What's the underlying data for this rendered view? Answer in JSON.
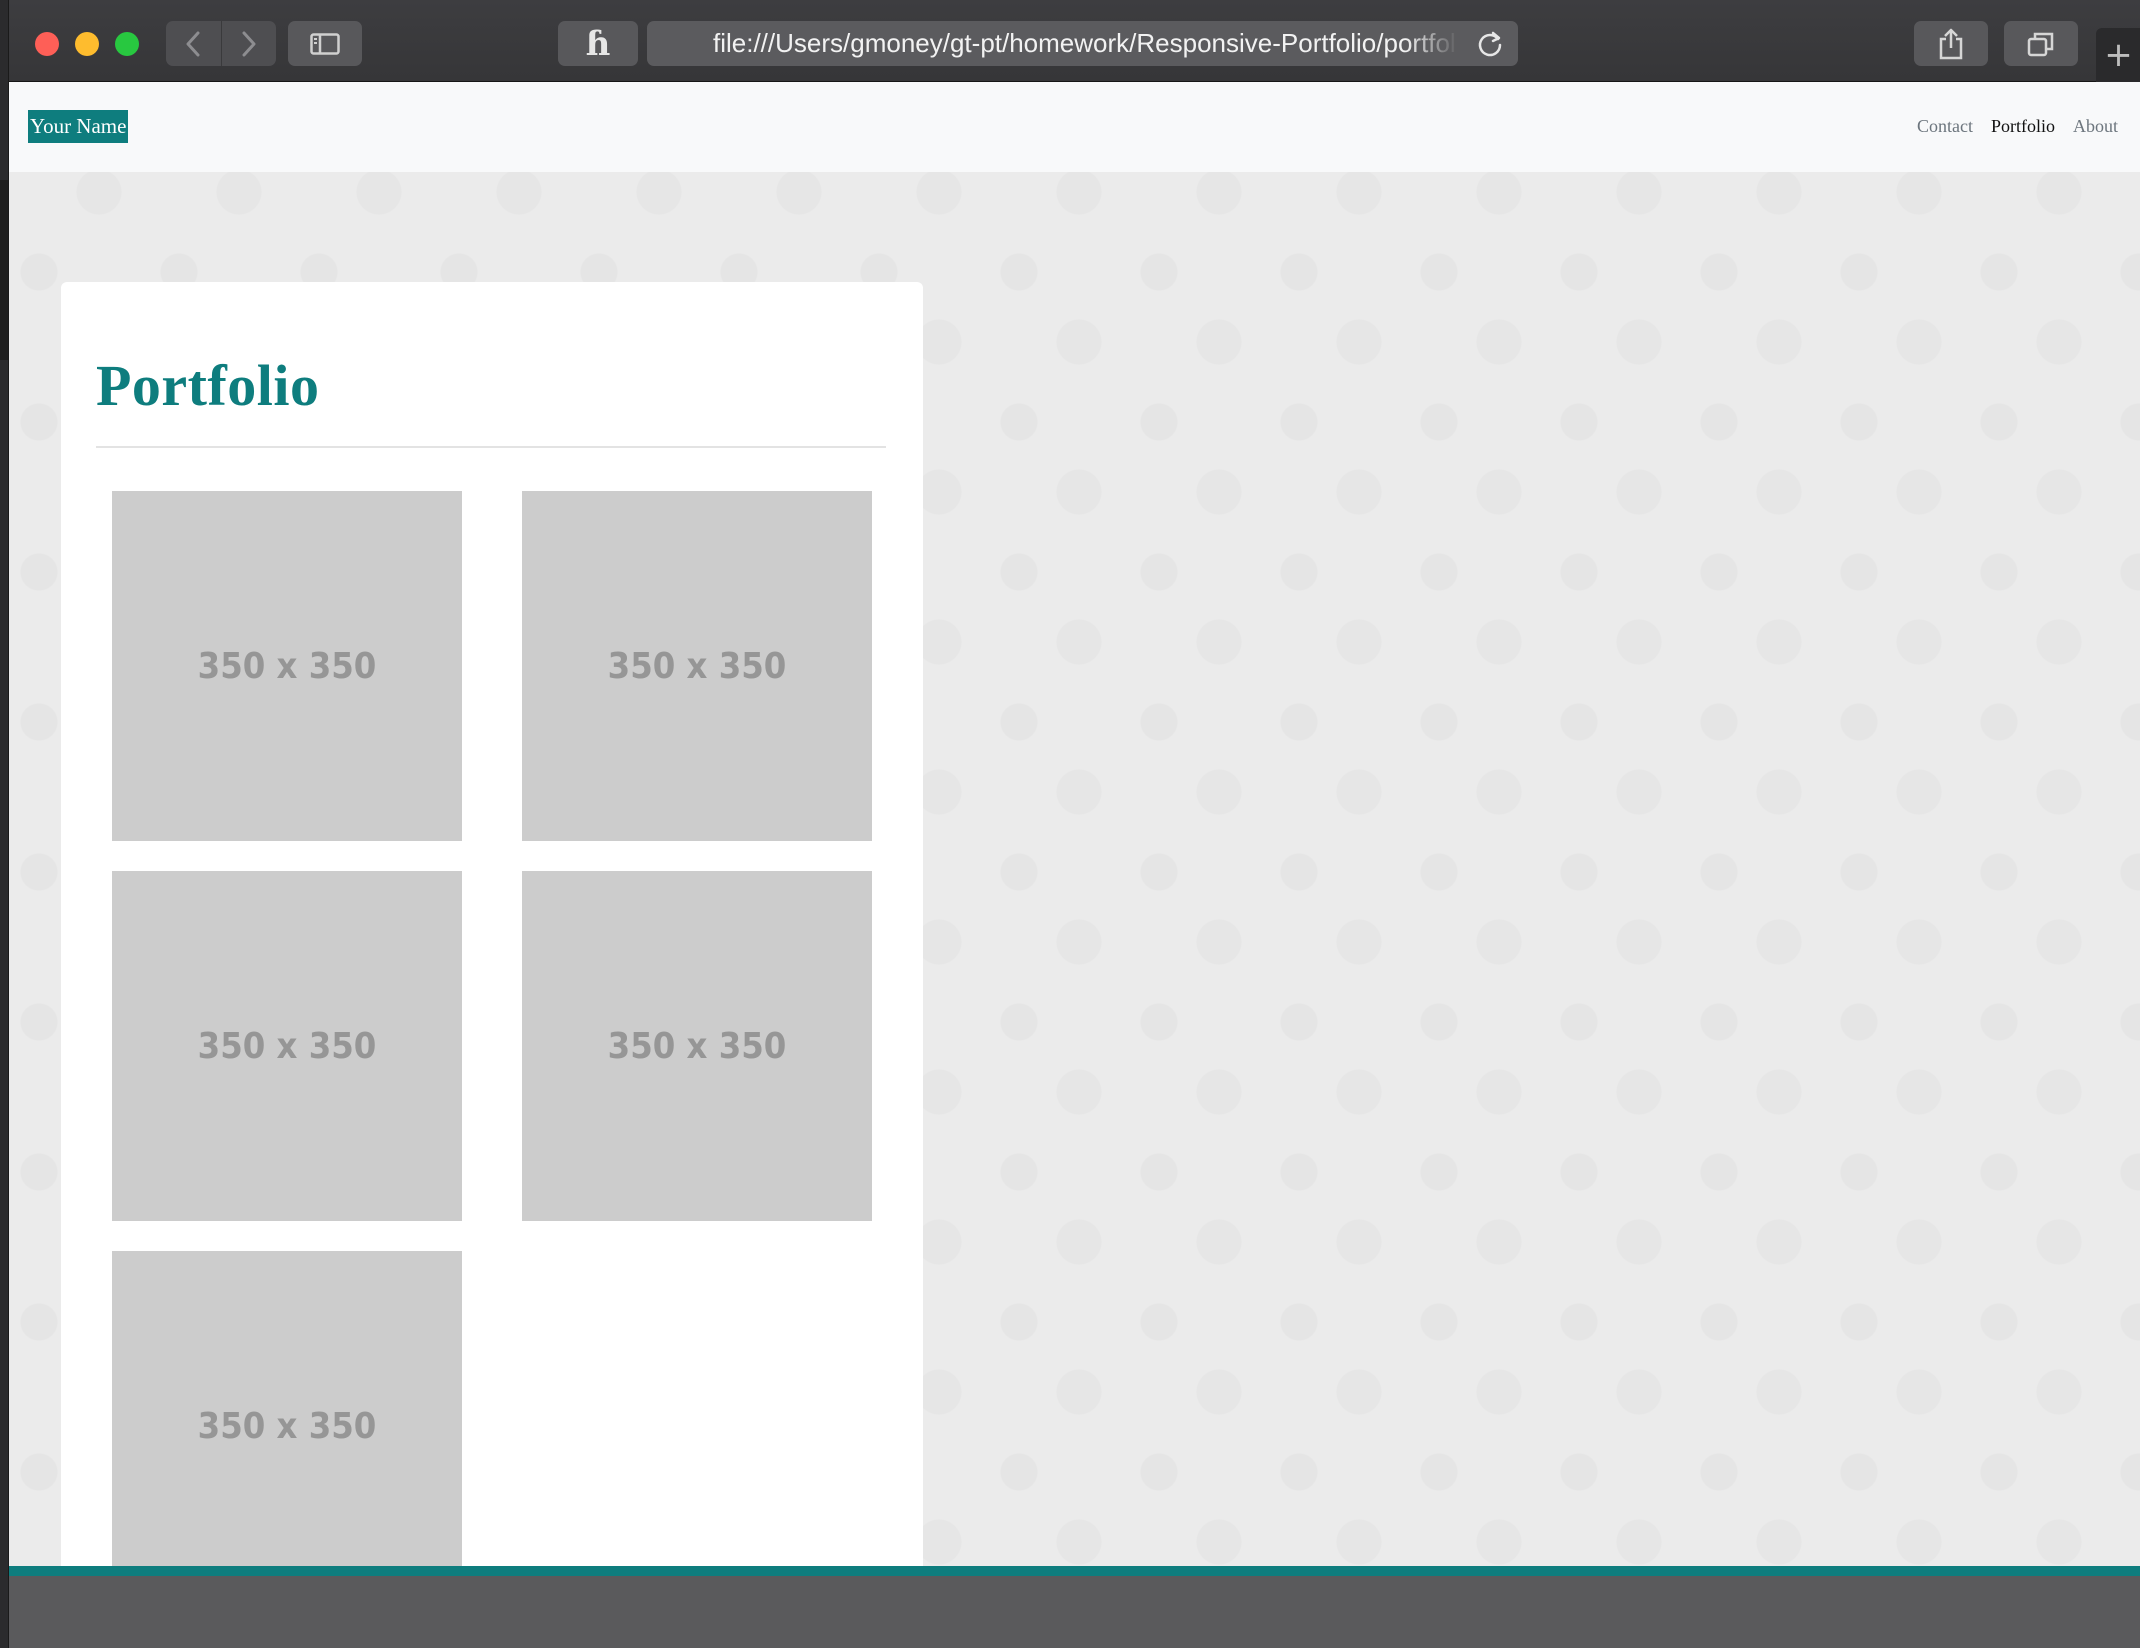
{
  "browser": {
    "address_url": "file:///Users/gmoney/gt-pt/homework/Responsive-Portfolio/portfolio.html",
    "extension_glyph": "ɦ",
    "new_tab_glyph": "+",
    "icons": {
      "back": "chevron-left-icon",
      "forward": "chevron-right-icon",
      "sidebar": "sidebar-icon",
      "reload": "reload-icon",
      "share": "share-icon",
      "tabs": "tabs-overview-icon"
    }
  },
  "navbar": {
    "brand": "Your Name",
    "links": [
      {
        "label": "Contact",
        "active": false
      },
      {
        "label": "Portfolio",
        "active": true
      },
      {
        "label": "About",
        "active": false
      }
    ]
  },
  "portfolio": {
    "title": "Portfolio",
    "thumbnails": [
      {
        "label": "350 x 350"
      },
      {
        "label": "350 x 350"
      },
      {
        "label": "350 x 350"
      },
      {
        "label": "350 x 350"
      },
      {
        "label": "350 x 350"
      }
    ]
  },
  "colors": {
    "accent": "#0e7d7e",
    "placeholder_bg": "#cccccc",
    "placeholder_text": "#969696",
    "footer": "#5a5a5c"
  }
}
